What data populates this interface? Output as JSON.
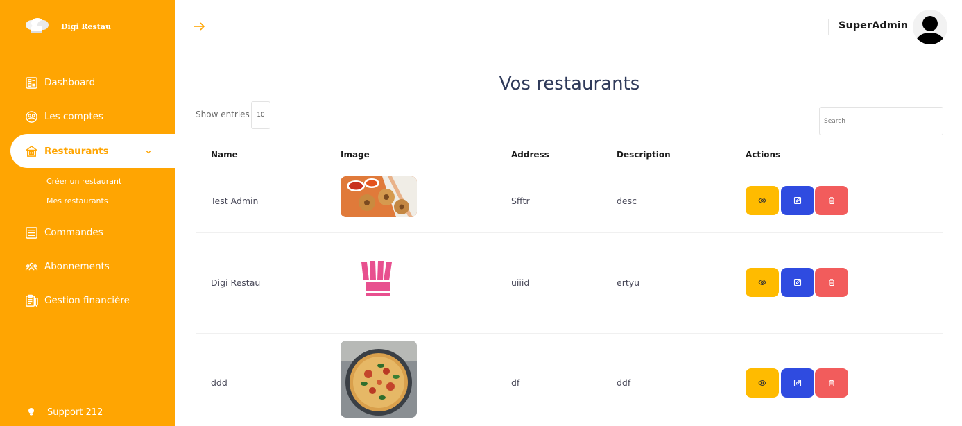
{
  "brand": {
    "name": "Digi Restau"
  },
  "sidebar": {
    "items": [
      {
        "label": "Dashboard",
        "icon": "dashboard-icon"
      },
      {
        "label": "Les comptes",
        "icon": "accounts-icon"
      },
      {
        "label": "Restaurants",
        "icon": "restaurant-icon",
        "active": true
      },
      {
        "label": "Commandes",
        "icon": "orders-icon"
      },
      {
        "label": "Abonnements",
        "icon": "subscriptions-icon"
      },
      {
        "label": "Gestion financière",
        "icon": "finance-icon"
      }
    ],
    "sub_items": [
      {
        "label": "Créer un restaurant"
      },
      {
        "label": "Mes restaurants"
      }
    ],
    "support": {
      "label": "Support 212",
      "icon": "lightbulb-icon"
    }
  },
  "header": {
    "user_name": "SuperAdmin"
  },
  "main": {
    "title": "Vos restaurants",
    "show_entries_label": "Show entries",
    "entries_value": "10",
    "search_placeholder": "Search",
    "columns": [
      "Name",
      "Image",
      "Address",
      "Description",
      "Actions"
    ],
    "rows": [
      {
        "name": "Test Admin",
        "image": "food-photo",
        "address": "Sfftr",
        "description": "desc"
      },
      {
        "name": "Digi Restau",
        "image": "chef-hat-logo",
        "address": "uiiid",
        "description": "ertyu"
      },
      {
        "name": "ddd",
        "image": "pizza-photo",
        "address": "df",
        "description": "ddf"
      }
    ]
  },
  "colors": {
    "sidebar_bg": "#ffa502",
    "view_button": "#ffbb00",
    "edit_button": "#2f4be0",
    "delete_button": "#f25c5c",
    "title": "#2f3a5a"
  }
}
